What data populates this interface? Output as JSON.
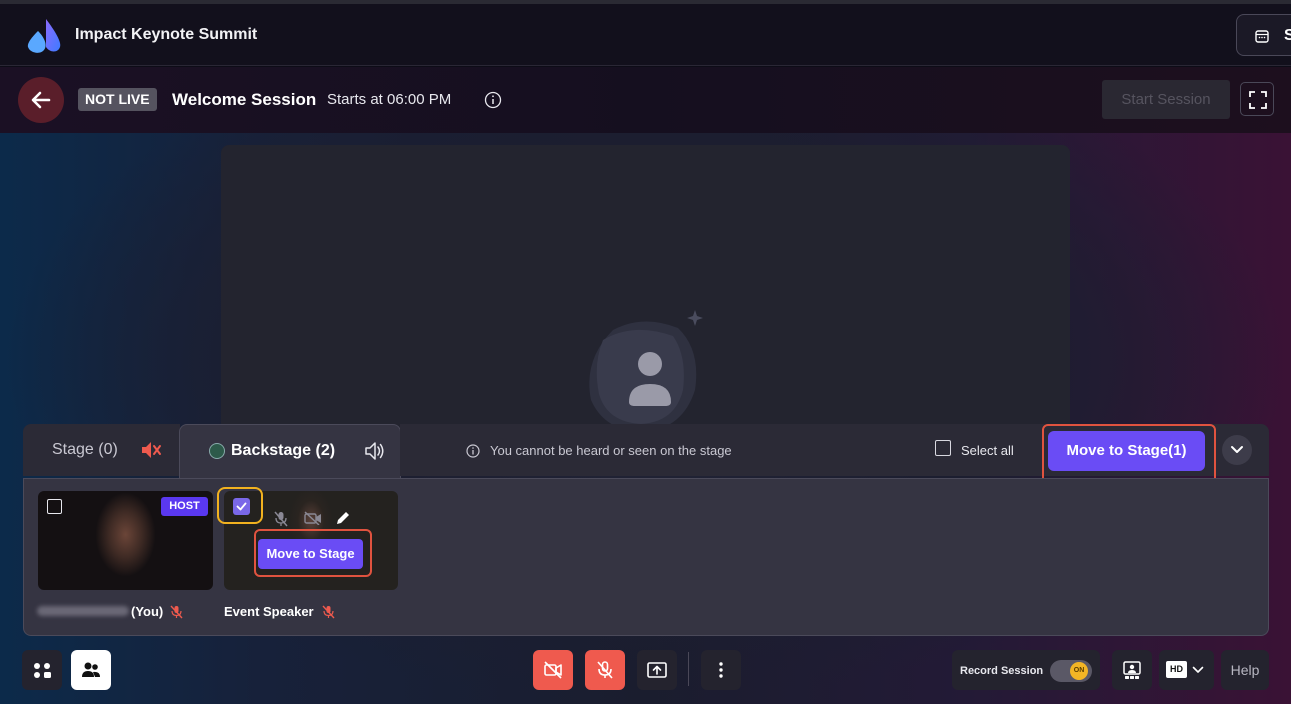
{
  "header": {
    "app_title": "Impact Keynote Summit",
    "schedule_label": "S"
  },
  "session": {
    "status_badge": "NOT LIVE",
    "title": "Welcome Session",
    "starts": "Starts at 06:00 PM",
    "start_button": "Start Session"
  },
  "tray": {
    "tabs": [
      {
        "label": "Stage (0)"
      },
      {
        "label": "Backstage (2)"
      }
    ],
    "hint": "You cannot be heard or seen on the stage",
    "select_all": "Select all",
    "move_all_button": "Move to Stage(1)"
  },
  "participants": [
    {
      "name": "(You)",
      "badge": "HOST",
      "selected": false
    },
    {
      "name": "Event Speaker",
      "selected": true,
      "move_button": "Move to Stage"
    }
  ],
  "controls": {
    "record_label": "Record Session",
    "record_toggle": "ON",
    "quality": "HD",
    "help": "Help"
  },
  "colors": {
    "accent": "#6a4cf5",
    "danger": "#ef5a4e",
    "highlight_red": "#e0533f",
    "highlight_yellow": "#f2b21f"
  }
}
